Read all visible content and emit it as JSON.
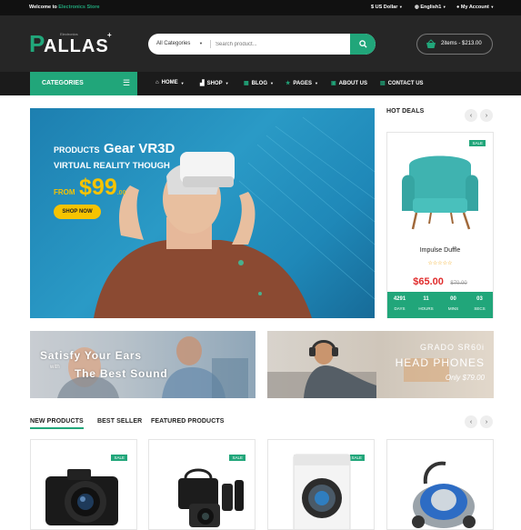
{
  "topbar": {
    "welcome_prefix": "Welcome to ",
    "welcome_store": "Electronics Store",
    "currency": "US Dollar",
    "language": "English1",
    "account": "My Account"
  },
  "header": {
    "logo_small": "Electronics",
    "logo": "ALLAS",
    "logo_p": "P"
  },
  "search": {
    "category": "All Categories",
    "placeholder": "Search product..."
  },
  "cart": {
    "label": "2items - $213.00"
  },
  "nav": {
    "categories": "CATEGORIES",
    "items": [
      "HOME",
      "SHOP",
      "BLOG",
      "PAGES",
      "ABOUT US",
      "CONTACT US"
    ]
  },
  "banner": {
    "line1a": "PRODUCTS",
    "line1b": "Gear VR3D",
    "line2": "VIRTUAL REALITY THOUGH",
    "from": "FROM",
    "price": "$99",
    "cents": ".00",
    "button": "SHOP NOW"
  },
  "hot_deals": {
    "title": "HOT DEALS",
    "badge": "SALE",
    "product": "Impulse Duffle",
    "stars": "☆☆☆☆☆",
    "price": "$65.00",
    "old_price": "$70.00",
    "countdown": [
      {
        "n": "4291",
        "l": "DAYS"
      },
      {
        "n": "11",
        "l": "HOURS"
      },
      {
        "n": "00",
        "l": "MINS"
      },
      {
        "n": "03",
        "l": "SECS"
      }
    ]
  },
  "promo_left": {
    "line1": "Satisfy Your Ears",
    "with": "with",
    "line2": "The Best Sound"
  },
  "promo_right": {
    "line1": "GRADO SR60i",
    "line2": "HEAD PHONES",
    "line3": "Only $79.00"
  },
  "tabs": [
    "NEW PRODUCTS",
    "BEST SELLER",
    "FEATURED PRODUCTS"
  ],
  "products": [
    {
      "badge": "SALE"
    },
    {
      "badge": "SALE"
    },
    {
      "badge": "SALE"
    },
    {
      "badge": ""
    }
  ],
  "colors": {
    "accent": "#21a67a",
    "dark": "#262626",
    "price_red": "#e02b2b"
  }
}
